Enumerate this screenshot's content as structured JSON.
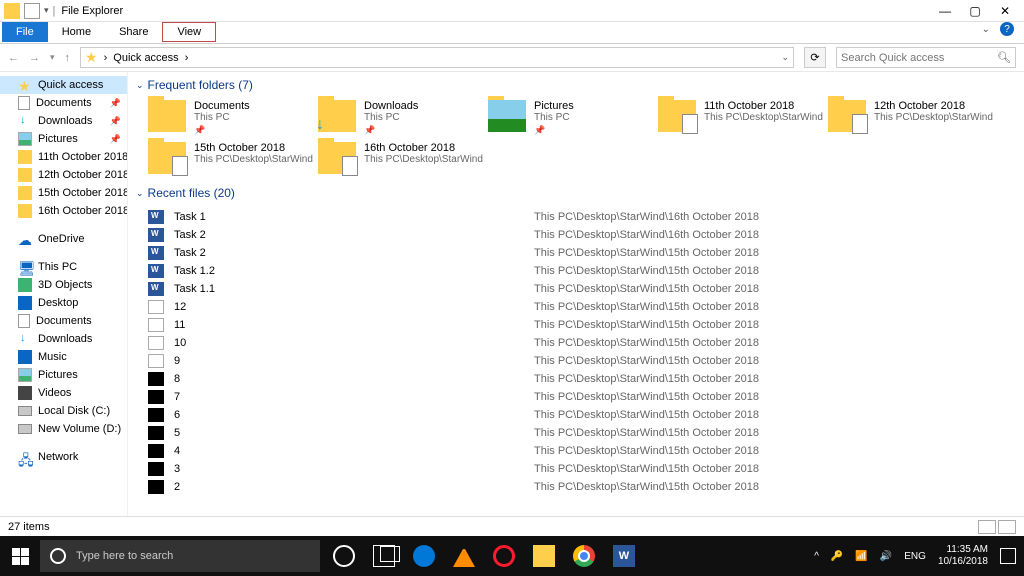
{
  "window": {
    "title": "File Explorer"
  },
  "ribbon": {
    "tabs": [
      "File",
      "Home",
      "Share",
      "View"
    ]
  },
  "address": {
    "root": "Quick access",
    "sep": "›",
    "search_placeholder": "Search Quick access"
  },
  "nav": {
    "quick": {
      "label": "Quick access",
      "items": [
        {
          "label": "Documents",
          "icon": "doc",
          "pin": true
        },
        {
          "label": "Downloads",
          "icon": "down",
          "pin": true
        },
        {
          "label": "Pictures",
          "icon": "pic",
          "pin": true
        },
        {
          "label": "11th October 2018",
          "icon": "fold"
        },
        {
          "label": "12th October 2018",
          "icon": "fold"
        },
        {
          "label": "15th October 2018",
          "icon": "fold"
        },
        {
          "label": "16th October 2018",
          "icon": "fold"
        }
      ]
    },
    "onedrive": "OneDrive",
    "thispc": {
      "label": "This PC",
      "items": [
        {
          "label": "3D Objects",
          "icon": "d3"
        },
        {
          "label": "Desktop",
          "icon": "desk"
        },
        {
          "label": "Documents",
          "icon": "doc"
        },
        {
          "label": "Downloads",
          "icon": "down"
        },
        {
          "label": "Music",
          "icon": "music"
        },
        {
          "label": "Pictures",
          "icon": "pic"
        },
        {
          "label": "Videos",
          "icon": "video"
        },
        {
          "label": "Local Disk (C:)",
          "icon": "disk"
        },
        {
          "label": "New Volume (D:)",
          "icon": "disk"
        }
      ]
    },
    "network": "Network"
  },
  "groups": {
    "folders": {
      "title": "Frequent folders (7)",
      "items": [
        {
          "name": "Documents",
          "loc": "This PC",
          "pin": true,
          "icon": ""
        },
        {
          "name": "Downloads",
          "loc": "This PC",
          "pin": true,
          "icon": "dl"
        },
        {
          "name": "Pictures",
          "loc": "This PC",
          "pin": true,
          "icon": "picf"
        },
        {
          "name": "11th October 2018",
          "loc": "This PC\\Desktop\\StarWind",
          "icon": "pc"
        },
        {
          "name": "12th October 2018",
          "loc": "This PC\\Desktop\\StarWind",
          "icon": "pc"
        },
        {
          "name": "15th October 2018",
          "loc": "This PC\\Desktop\\StarWind",
          "icon": "pc"
        },
        {
          "name": "16th October 2018",
          "loc": "This PC\\Desktop\\StarWind",
          "icon": "pc"
        }
      ]
    },
    "recent": {
      "title": "Recent files (20)",
      "items": [
        {
          "name": "Task 1",
          "path": "This PC\\Desktop\\StarWind\\16th October 2018",
          "icon": "word"
        },
        {
          "name": "Task 2",
          "path": "This PC\\Desktop\\StarWind\\16th October 2018",
          "icon": "word"
        },
        {
          "name": "Task 2",
          "path": "This PC\\Desktop\\StarWind\\15th October 2018",
          "icon": "word"
        },
        {
          "name": "Task 1.2",
          "path": "This PC\\Desktop\\StarWind\\15th October 2018",
          "icon": "word"
        },
        {
          "name": "Task 1.1",
          "path": "This PC\\Desktop\\StarWind\\15th October 2018",
          "icon": "word"
        },
        {
          "name": "12",
          "path": "This PC\\Desktop\\StarWind\\15th October 2018",
          "icon": "img"
        },
        {
          "name": "11",
          "path": "This PC\\Desktop\\StarWind\\15th October 2018",
          "icon": "img"
        },
        {
          "name": "10",
          "path": "This PC\\Desktop\\StarWind\\15th October 2018",
          "icon": "img"
        },
        {
          "name": "9",
          "path": "This PC\\Desktop\\StarWind\\15th October 2018",
          "icon": "img"
        },
        {
          "name": "8",
          "path": "This PC\\Desktop\\StarWind\\15th October 2018",
          "icon": "bimg"
        },
        {
          "name": "7",
          "path": "This PC\\Desktop\\StarWind\\15th October 2018",
          "icon": "bimg"
        },
        {
          "name": "6",
          "path": "This PC\\Desktop\\StarWind\\15th October 2018",
          "icon": "bimg"
        },
        {
          "name": "5",
          "path": "This PC\\Desktop\\StarWind\\15th October 2018",
          "icon": "bimg"
        },
        {
          "name": "4",
          "path": "This PC\\Desktop\\StarWind\\15th October 2018",
          "icon": "bimg"
        },
        {
          "name": "3",
          "path": "This PC\\Desktop\\StarWind\\15th October 2018",
          "icon": "bimg"
        },
        {
          "name": "2",
          "path": "This PC\\Desktop\\StarWind\\15th October 2018",
          "icon": "bimg"
        }
      ]
    }
  },
  "status": {
    "text": "27 items"
  },
  "taskbar": {
    "search_placeholder": "Type here to search",
    "time": "11:35 AM",
    "date": "10/16/2018",
    "lang": "ENG",
    "tray_icons": [
      "^",
      "🔑",
      "📶",
      "🔊"
    ]
  }
}
